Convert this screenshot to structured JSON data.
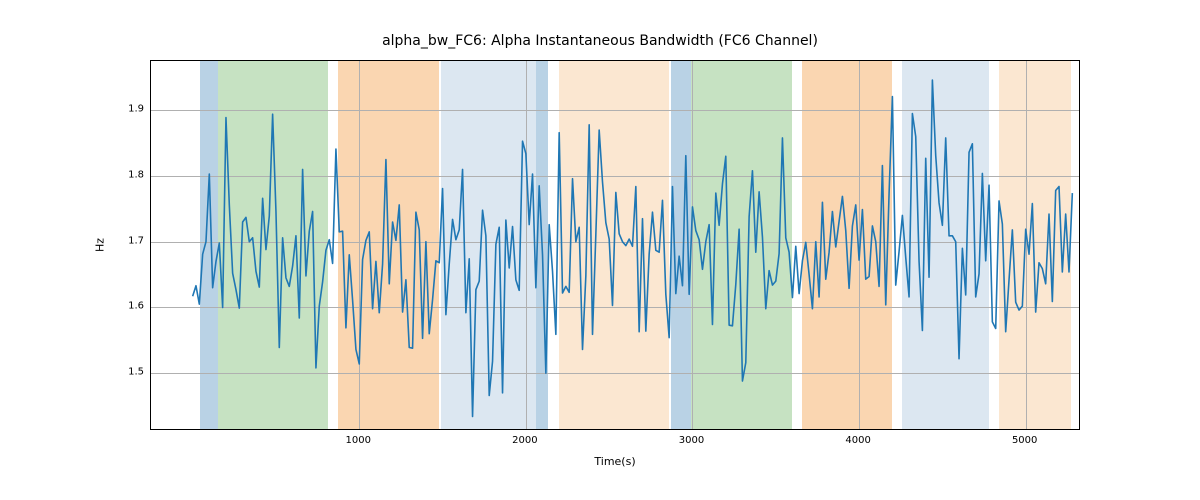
{
  "chart_data": {
    "type": "line",
    "title": "alpha_bw_FC6: Alpha Instantaneous Bandwidth (FC6 Channel)",
    "xlabel": "Time(s)",
    "ylabel": "Hz",
    "xlim": [
      -250,
      5320
    ],
    "ylim": [
      1.415,
      1.975
    ],
    "xticks": [
      1000,
      2000,
      3000,
      4000,
      5000
    ],
    "yticks": [
      1.5,
      1.6,
      1.7,
      1.8,
      1.9
    ],
    "bands": [
      {
        "start": 45,
        "end": 150,
        "color": "#a7c7de",
        "opacity": 0.8
      },
      {
        "start": 150,
        "end": 810,
        "color": "#b8dbb3",
        "opacity": 0.8
      },
      {
        "start": 870,
        "end": 1480,
        "color": "#f9cc9d",
        "opacity": 0.8
      },
      {
        "start": 1490,
        "end": 2060,
        "color": "#d8e4f0",
        "opacity": 0.9
      },
      {
        "start": 2060,
        "end": 2130,
        "color": "#a7c7de",
        "opacity": 0.8
      },
      {
        "start": 2200,
        "end": 2860,
        "color": "#fbe4cc",
        "opacity": 0.9
      },
      {
        "start": 2870,
        "end": 2990,
        "color": "#a7c7de",
        "opacity": 0.8
      },
      {
        "start": 2990,
        "end": 3600,
        "color": "#b8dbb3",
        "opacity": 0.8
      },
      {
        "start": 3660,
        "end": 4200,
        "color": "#f9cc9d",
        "opacity": 0.8
      },
      {
        "start": 4260,
        "end": 4780,
        "color": "#d8e4f0",
        "opacity": 0.9
      },
      {
        "start": 4840,
        "end": 5270,
        "color": "#fbe4cc",
        "opacity": 0.9
      }
    ],
    "series": [
      {
        "name": "alpha_bw_FC6",
        "color": "#1f77b4",
        "x_start": 0,
        "x_step": 20,
        "values": [
          1.617,
          1.633,
          1.605,
          1.681,
          1.7,
          1.803,
          1.63,
          1.67,
          1.698,
          1.6,
          1.889,
          1.756,
          1.652,
          1.627,
          1.599,
          1.73,
          1.737,
          1.7,
          1.706,
          1.655,
          1.631,
          1.766,
          1.688,
          1.739,
          1.894,
          1.746,
          1.539,
          1.706,
          1.645,
          1.632,
          1.663,
          1.709,
          1.584,
          1.81,
          1.648,
          1.716,
          1.746,
          1.508,
          1.602,
          1.639,
          1.687,
          1.703,
          1.667,
          1.841,
          1.715,
          1.716,
          1.569,
          1.68,
          1.611,
          1.536,
          1.514,
          1.673,
          1.702,
          1.715,
          1.598,
          1.67,
          1.592,
          1.666,
          1.825,
          1.636,
          1.73,
          1.702,
          1.756,
          1.593,
          1.642,
          1.539,
          1.538,
          1.745,
          1.718,
          1.553,
          1.7,
          1.56,
          1.612,
          1.671,
          1.668,
          1.781,
          1.589,
          1.666,
          1.734,
          1.703,
          1.718,
          1.81,
          1.592,
          1.674,
          1.434,
          1.627,
          1.64,
          1.748,
          1.709,
          1.466,
          1.518,
          1.696,
          1.722,
          1.47,
          1.733,
          1.66,
          1.723,
          1.642,
          1.626,
          1.853,
          1.834,
          1.726,
          1.803,
          1.63,
          1.785,
          1.68,
          1.5,
          1.726,
          1.655,
          1.559,
          1.866,
          1.622,
          1.632,
          1.623,
          1.796,
          1.7,
          1.722,
          1.536,
          1.648,
          1.878,
          1.559,
          1.711,
          1.87,
          1.791,
          1.729,
          1.704,
          1.603,
          1.775,
          1.712,
          1.7,
          1.694,
          1.704,
          1.693,
          1.784,
          1.563,
          1.735,
          1.564,
          1.681,
          1.745,
          1.687,
          1.684,
          1.763,
          1.62,
          1.554,
          1.784,
          1.621,
          1.678,
          1.633,
          1.831,
          1.62,
          1.753,
          1.717,
          1.703,
          1.658,
          1.7,
          1.726,
          1.574,
          1.774,
          1.725,
          1.788,
          1.83,
          1.573,
          1.572,
          1.635,
          1.719,
          1.488,
          1.516,
          1.738,
          1.808,
          1.684,
          1.776,
          1.707,
          1.598,
          1.656,
          1.634,
          1.64,
          1.682,
          1.858,
          1.706,
          1.684,
          1.615,
          1.693,
          1.621,
          1.671,
          1.699,
          1.65,
          1.598,
          1.7,
          1.616,
          1.76,
          1.643,
          1.684,
          1.746,
          1.692,
          1.731,
          1.769,
          1.717,
          1.629,
          1.724,
          1.756,
          1.672,
          1.749,
          1.643,
          1.647,
          1.724,
          1.7,
          1.632,
          1.816,
          1.604,
          1.773,
          1.921,
          1.634,
          1.685,
          1.74,
          1.676,
          1.616,
          1.895,
          1.86,
          1.67,
          1.565,
          1.827,
          1.646,
          1.946,
          1.831,
          1.759,
          1.725,
          1.858,
          1.709,
          1.709,
          1.7,
          1.522,
          1.69,
          1.619,
          1.836,
          1.849,
          1.616,
          1.651,
          1.804,
          1.671,
          1.786,
          1.578,
          1.568,
          1.762,
          1.727,
          1.563,
          1.642,
          1.718,
          1.608,
          1.596,
          1.602,
          1.719,
          1.681,
          1.758,
          1.593,
          1.668,
          1.659,
          1.636,
          1.742,
          1.609,
          1.778,
          1.784,
          1.654,
          1.742,
          1.654,
          1.774
        ]
      }
    ]
  }
}
